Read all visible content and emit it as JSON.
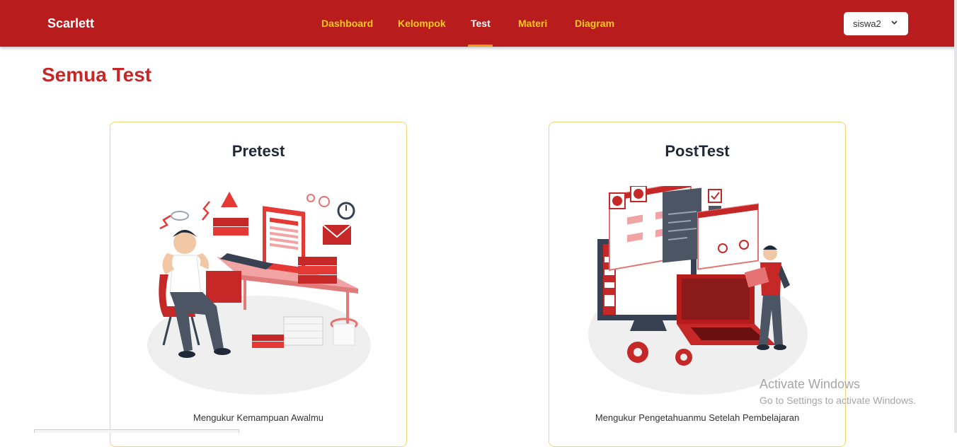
{
  "navbar": {
    "brand": "Scarlett",
    "links": [
      {
        "label": "Dashboard"
      },
      {
        "label": "Kelompok"
      },
      {
        "label": "Test"
      },
      {
        "label": "Materi"
      },
      {
        "label": "Diagram"
      }
    ],
    "active_link": "Test",
    "user": "siswa2"
  },
  "page": {
    "title": "Semua Test"
  },
  "cards": [
    {
      "title": "Pretest",
      "description": "Mengukur Kemampuan Awalmu"
    },
    {
      "title": "PostTest",
      "description": "Mengukur Pengetahuanmu Setelah Pembelajaran"
    }
  ],
  "watermark": {
    "line1": "Activate Windows",
    "line2": "Go to Settings to activate Windows."
  },
  "colors": {
    "navbar": "#b91c1c",
    "nav_link": "#facc15",
    "title": "#c62828",
    "card_border": "#f1d679"
  },
  "icons": [
    "chevron-down-icon"
  ]
}
